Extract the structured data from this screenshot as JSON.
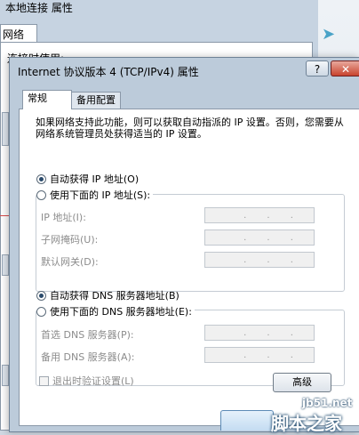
{
  "background_window": {
    "title": "本地连接 属性",
    "tab": "网络",
    "connect_using": "连接时使用:"
  },
  "dialog": {
    "title": "Internet 协议版本 4 (TCP/IPv4) 属性",
    "help_label": "?",
    "close_label": "✕",
    "tabs": [
      "常规",
      "备用配置"
    ],
    "description": "如果网络支持此功能，则可以获取自动指派的 IP 设置。否则，您需要从网络系统管理员处获得适当的 IP 设置。",
    "ip": {
      "auto_label": "自动获得 IP 地址(O)",
      "manual_label": "使用下面的 IP 地址(S):",
      "selected": "auto",
      "fields": [
        {
          "label": "IP 地址(I):"
        },
        {
          "label": "子网掩码(U):"
        },
        {
          "label": "默认网关(D):"
        }
      ]
    },
    "dns": {
      "auto_label": "自动获得 DNS 服务器地址(B)",
      "manual_label": "使用下面的 DNS 服务器地址(E):",
      "selected": "auto",
      "fields": [
        {
          "label": "首选 DNS 服务器(P):"
        },
        {
          "label": "备用 DNS 服务器(A):"
        }
      ]
    },
    "validate_label": "退出时验证设置(L)",
    "advanced_label": "高级"
  },
  "watermark": {
    "url": "jb51.net",
    "name": "脚本之家"
  }
}
